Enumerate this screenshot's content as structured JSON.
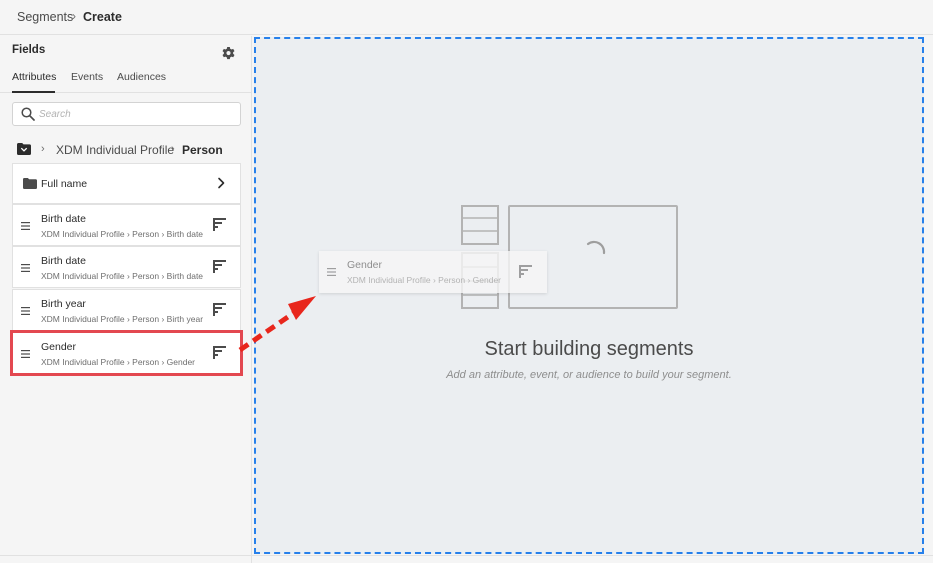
{
  "breadcrumb": {
    "root": "Segments",
    "separator": "›",
    "current": "Create"
  },
  "fields": {
    "title": "Fields",
    "tabs": [
      {
        "label": "Attributes",
        "active": true
      },
      {
        "label": "Events",
        "active": false
      },
      {
        "label": "Audiences",
        "active": false
      }
    ],
    "search_placeholder": "Search",
    "path": {
      "profile": "XDM Individual Profile",
      "current": "Person"
    },
    "folder_row": {
      "label": "Full name"
    },
    "attributes": [
      {
        "name": "Birth date",
        "path": "XDM Individual Profile › Person › Birth date"
      },
      {
        "name": "Birth date",
        "path": "XDM Individual Profile › Person › Birth date"
      },
      {
        "name": "Birth year",
        "path": "XDM Individual Profile › Person › Birth year"
      },
      {
        "name": "Gender",
        "path": "XDM Individual Profile › Person › Gender"
      }
    ]
  },
  "canvas": {
    "title": "Start building segments",
    "subtitle": "Add an attribute, event, or audience to build your segment."
  },
  "drag_ghost": {
    "name": "Gender",
    "path": "XDM Individual Profile › Person › Gender"
  },
  "colors": {
    "accent_blue": "#2680eb",
    "highlight_red": "#e34850",
    "arrow_red": "#e8261c"
  },
  "icons": [
    "gear-icon",
    "search-icon",
    "folder-icon",
    "chevron-right-icon",
    "drag-handle-icon",
    "data-type-icon",
    "spinner-icon",
    "arrow-annotation"
  ]
}
